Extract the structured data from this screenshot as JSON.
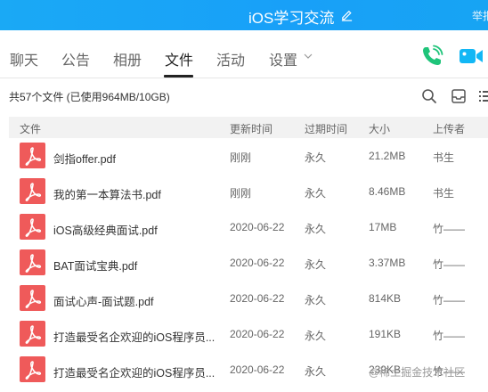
{
  "window": {
    "title": "iOS学习交流",
    "report_label": "举报"
  },
  "tabs": [
    {
      "label": "聊天"
    },
    {
      "label": "公告"
    },
    {
      "label": "相册"
    },
    {
      "label": "文件",
      "active": true
    },
    {
      "label": "活动"
    },
    {
      "label": "设置"
    }
  ],
  "summary": "共57个文件 (已使用964MB/10GB)",
  "table": {
    "headers": [
      "文件",
      "更新时间",
      "过期时间",
      "大小",
      "上传者"
    ],
    "rows": [
      {
        "name": "剑指offer.pdf",
        "updated": "刚刚",
        "expires": "永久",
        "size": "21.2MB",
        "uploader": "书生"
      },
      {
        "name": "我的第一本算法书.pdf",
        "updated": "刚刚",
        "expires": "永久",
        "size": "8.46MB",
        "uploader": "书生"
      },
      {
        "name": "iOS高级经典面试.pdf",
        "updated": "2020-06-22",
        "expires": "永久",
        "size": "17MB",
        "uploader": "竹——"
      },
      {
        "name": "BAT面试宝典.pdf",
        "updated": "2020-06-22",
        "expires": "永久",
        "size": "3.37MB",
        "uploader": "竹——"
      },
      {
        "name": "面试心声-面试题.pdf",
        "updated": "2020-06-22",
        "expires": "永久",
        "size": "814KB",
        "uploader": "竹——"
      },
      {
        "name": "打造最受名企欢迎的iOS程序员...",
        "updated": "2020-06-22",
        "expires": "永久",
        "size": "191KB",
        "uploader": "竹——"
      },
      {
        "name": "打造最受名企欢迎的iOS程序员...",
        "updated": "2020-06-22",
        "expires": "永久",
        "size": "239KB",
        "uploader": "竹——"
      }
    ]
  },
  "watermark": "@稀土掘金技术社区",
  "colors": {
    "titlebar": "#18a3f6",
    "accent_green": "#1fc47a",
    "accent_cyan": "#12b7f5",
    "pdf_red": "#ef5a5a",
    "header_bg": "#f2f2f2"
  },
  "icons": {
    "edit": "edit-icon",
    "phone": "phone-icon",
    "video": "video-camera-icon",
    "search": "search-icon",
    "inbox": "inbox-icon",
    "list": "list-view-icon",
    "file": "pdf-file-icon"
  }
}
